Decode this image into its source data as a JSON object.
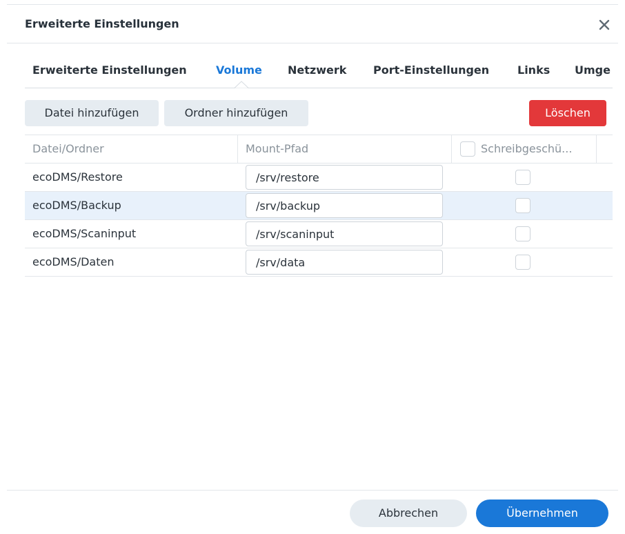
{
  "dialog": {
    "title": "Erweiterte Einstellungen",
    "close_icon": "close-icon"
  },
  "tabs": [
    {
      "label": "Erweiterte Einstellungen",
      "active": false
    },
    {
      "label": "Volume",
      "active": true
    },
    {
      "label": "Netzwerk",
      "active": false
    },
    {
      "label": "Port-Einstellungen",
      "active": false
    },
    {
      "label": "Links",
      "active": false
    },
    {
      "label": "Umge",
      "active": false
    }
  ],
  "toolbar": {
    "add_file_label": "Datei hinzufügen",
    "add_folder_label": "Ordner hinzufügen",
    "delete_label": "Löschen"
  },
  "table": {
    "columns": [
      "Datei/Ordner",
      "Mount-Pfad",
      "Schreibgeschü..."
    ],
    "rows": [
      {
        "name": "ecoDMS/Restore",
        "mount_path": "/srv/restore",
        "readonly": false,
        "selected": false
      },
      {
        "name": "ecoDMS/Backup",
        "mount_path": "/srv/backup",
        "readonly": false,
        "selected": true
      },
      {
        "name": "ecoDMS/Scaninput",
        "mount_path": "/srv/scaninput",
        "readonly": false,
        "selected": false
      },
      {
        "name": "ecoDMS/Daten",
        "mount_path": "/srv/data",
        "readonly": false,
        "selected": false
      }
    ]
  },
  "footer": {
    "cancel_label": "Abbrechen",
    "apply_label": "Übernehmen"
  },
  "colors": {
    "accent": "#1a78d8",
    "danger": "#e3383a",
    "selected_row": "#e8f1fb",
    "secondary_button": "#e6ecf1"
  }
}
